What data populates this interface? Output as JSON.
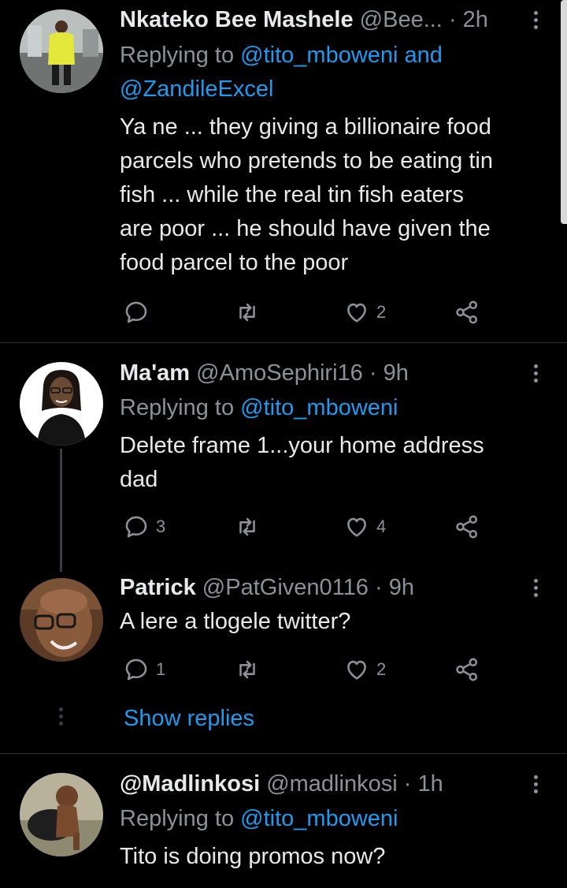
{
  "colors": {
    "background": "#000000",
    "link": "#1d9bf0",
    "muted": "#8b9199",
    "text": "#e7e9ea"
  },
  "tweets": [
    {
      "name": "Nkateko Bee Mashele",
      "handle": "@Bee...",
      "dot": "·",
      "time": "2h",
      "replying_prefix": "Replying to ",
      "replying_1": "@tito_mboweni",
      "replying_mid": " and",
      "replying_2": "@ZandileExcel",
      "lines": [
        "Ya ne ... they giving a billionaire food",
        "parcels who pretends to be eating tin",
        "fish ... while the real tin fish eaters",
        "are poor ... he should have given the",
        "food parcel to the poor"
      ],
      "reply_count": "",
      "like_count": "2",
      "avatar_icon": "user-avatar-yellow-jacket"
    },
    {
      "name": "Ma'am",
      "handle": "@AmoSephiri16",
      "dot": "·",
      "time": "9h",
      "replying_prefix": "Replying to ",
      "replying_1": "@tito_mboweni",
      "lines": [
        "Delete frame 1...your home address",
        "dad"
      ],
      "reply_count": "3",
      "like_count": "4",
      "avatar_icon": "user-avatar-woman"
    },
    {
      "name": "Patrick",
      "handle": "@PatGiven0116",
      "dot": "·",
      "time": "9h",
      "lines": [
        "A lere a tlogele twitter?"
      ],
      "reply_count": "1",
      "like_count": "2",
      "avatar_icon": "user-avatar-glasses"
    },
    {
      "name": "@Madlinkosi",
      "handle": "@madlinkosi",
      "dot": "·",
      "time": "1h",
      "replying_prefix": "Replying to ",
      "replying_1": "@tito_mboweni",
      "lines": [
        "Tito is doing promos now?"
      ],
      "avatar_icon": "user-avatar-child"
    }
  ],
  "show_replies": "Show replies",
  "icons": {
    "reply": "reply-icon",
    "retweet": "retweet-icon",
    "like": "heart-icon",
    "share": "share-icon",
    "more": "more-vertical-icon"
  }
}
